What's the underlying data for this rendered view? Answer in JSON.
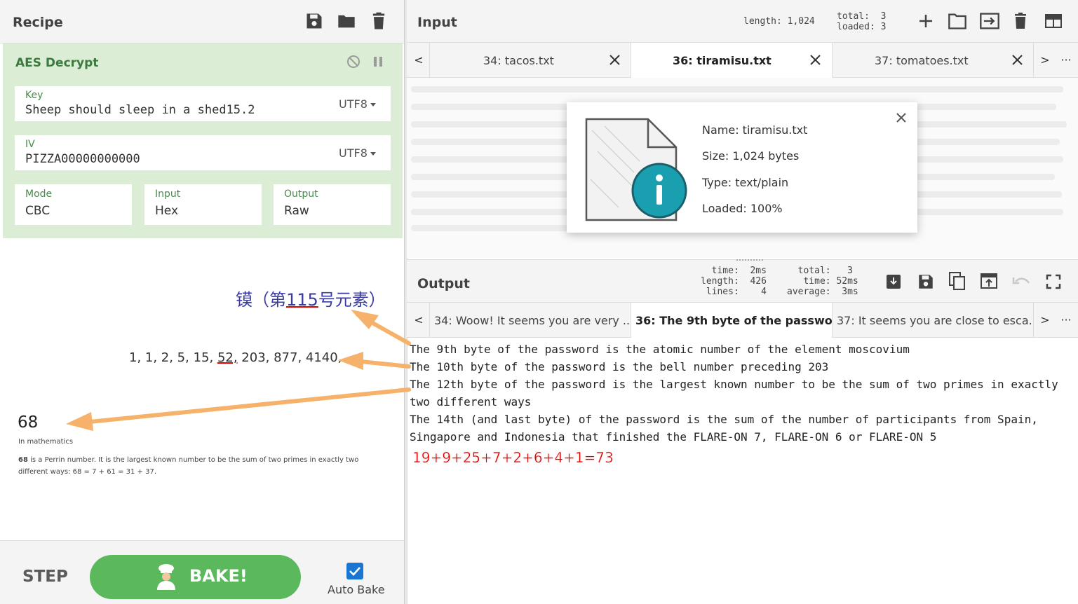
{
  "recipe": {
    "title": "Recipe",
    "operation": {
      "name": "AES Decrypt",
      "key": {
        "label": "Key",
        "value": "Sheep should sleep in a shed15.2",
        "encoding": "UTF8"
      },
      "iv": {
        "label": "IV",
        "value": "PIZZA00000000000",
        "encoding": "UTF8"
      },
      "mode": {
        "label": "Mode",
        "value": "CBC"
      },
      "input": {
        "label": "Input",
        "value": "Hex"
      },
      "output": {
        "label": "Output",
        "value": "Raw"
      }
    },
    "step_label": "STEP",
    "bake_label": "BAKE!",
    "autobake_label": "Auto Bake",
    "autobake_checked": true
  },
  "references": {
    "element": {
      "prefix": "镆（第",
      "number": "115",
      "suffix": "号元素）"
    },
    "bell": {
      "before": "1, 1, 2, 5, 15, ",
      "highlight": "52,",
      "after": " 203, 877, 4140, ..."
    },
    "sixty_eight": {
      "number": "68",
      "subtitle": "In mathematics",
      "bold": "68",
      "text": " is a Perrin number. It is the largest known number to be the sum of two primes in exactly two different ways: 68 = 7 + 61 = 31 + 37."
    }
  },
  "input": {
    "title": "Input",
    "length_text": "length: 1,024",
    "total_text": "total:  3\nloaded: 3",
    "tabs": [
      {
        "label": "34: tacos.txt"
      },
      {
        "label": "36: tiramisu.txt"
      },
      {
        "label": "37: tomatoes.txt"
      }
    ],
    "nav_prev": "<",
    "nav_next": ">",
    "nav_more": "···",
    "file": {
      "name": "Name: tiramisu.txt",
      "size": "Size: 1,024 bytes",
      "type": "Type: text/plain",
      "loaded": "Loaded: 100%"
    }
  },
  "output": {
    "title": "Output",
    "stats_left": "  time:  2ms\nlength:  426\n lines:    4",
    "stats_right": "  total:   3\n   time: 52ms\naverage:  3ms",
    "tabs": [
      {
        "label": "34: Woow! It seems you are very ..."
      },
      {
        "label": "36: The 9th byte of the passwo..."
      },
      {
        "label": "37: It seems you are close to esca..."
      }
    ],
    "text": "The 9th byte of the password is the atomic number of the element moscovium\nThe 10th byte of the password is the bell number preceding 203\nThe 12th byte of the password is the largest known number to be the sum of two primes in exactly\ntwo different ways\nThe 14th (and last byte) of the password is the sum of the number of participants from Spain,\nSingapore and Indonesia that finished the FLARE-ON 7, FLARE-ON 6 or FLARE-ON 5",
    "annotation": "19+9+25+7+2+6+4+1=73"
  },
  "colors": {
    "bake_green": "#5cb85c",
    "operation_bg": "#dcedd5",
    "arrow": "#f6b26b",
    "annotation_red": "#e00000"
  }
}
